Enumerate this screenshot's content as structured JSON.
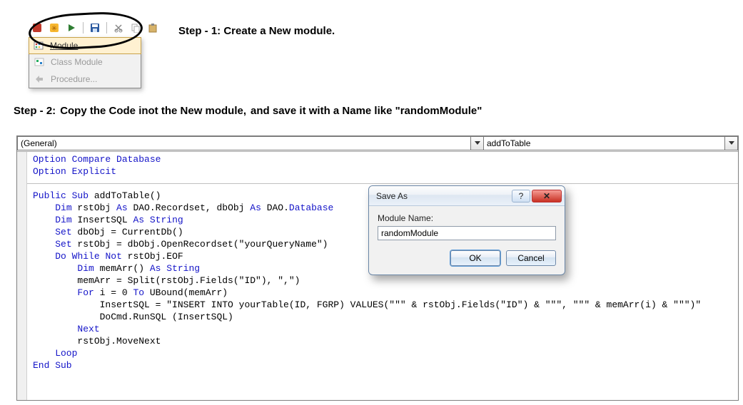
{
  "toolbar": {
    "icons": [
      "app-icon",
      "break-icon",
      "macro-icon",
      "save-icon",
      "cut-icon",
      "copy-icon",
      "paste-icon"
    ]
  },
  "insert_menu": {
    "items": [
      {
        "icon": "module-icon",
        "label": "Module",
        "highlight": true,
        "disabled": false
      },
      {
        "icon": "class-module-icon",
        "label": "Class Module",
        "highlight": false,
        "disabled": true
      },
      {
        "icon": "procedure-icon",
        "label": "Procedure...",
        "highlight": false,
        "disabled": true
      }
    ]
  },
  "step1": "Step - 1: Create a New module.",
  "step2_a": "Step - 2:",
  "step2_b": "Copy the Code inot the New module,",
  "step2_c": "and save it with a Name like \"randomModule\"",
  "editor": {
    "left_dropdown": "(General)",
    "right_dropdown": "addToTable",
    "code_lines": [
      {
        "t": "Option Compare Database",
        "c": "kw"
      },
      {
        "t": "Option Explicit",
        "c": "kw"
      },
      {
        "t": "",
        "c": ""
      },
      {
        "t": "Public Sub addToTable()",
        "c": "mix1"
      },
      {
        "t": "    Dim rstObj As DAO.Recordset, dbObj As DAO.Database",
        "c": "mix2"
      },
      {
        "t": "    Dim InsertSQL As String",
        "c": "mix3"
      },
      {
        "t": "    Set dbObj = CurrentDb()",
        "c": "mix4"
      },
      {
        "t": "    Set rstObj = dbObj.OpenRecordset(\"yourQueryName\")",
        "c": "mix5"
      },
      {
        "t": "    Do While Not rstObj.EOF",
        "c": "mix6"
      },
      {
        "t": "        Dim memArr() As String",
        "c": "mix7"
      },
      {
        "t": "        memArr = Split(rstObj.Fields(\"ID\"), \",\")",
        "c": "plain"
      },
      {
        "t": "        For i = 0 To UBound(memArr)",
        "c": "mix8"
      },
      {
        "t": "            InsertSQL = \"INSERT INTO yourTable(ID, FGRP) VALUES(\"\"\" & rstObj.Fields(\"ID\") & \"\"\", \"\"\" & memArr(i) & \"\"\")\"",
        "c": "plain"
      },
      {
        "t": "            DoCmd.RunSQL (InsertSQL)",
        "c": "plain"
      },
      {
        "t": "        Next",
        "c": "kw"
      },
      {
        "t": "        rstObj.MoveNext",
        "c": "plain"
      },
      {
        "t": "    Loop",
        "c": "kw"
      },
      {
        "t": "End Sub",
        "c": "kw"
      }
    ]
  },
  "dialog": {
    "title": "Save As",
    "label": "Module Name:",
    "value": "randomModule",
    "ok": "OK",
    "cancel": "Cancel"
  }
}
